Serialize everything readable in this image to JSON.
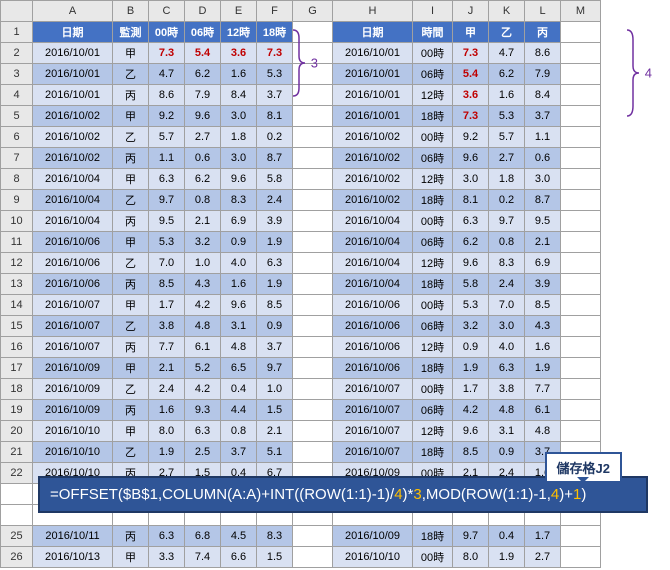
{
  "columns": [
    "A",
    "B",
    "C",
    "D",
    "E",
    "F",
    "G",
    "H",
    "I",
    "J",
    "K",
    "L",
    "M"
  ],
  "header_left": {
    "A": "日期",
    "B": "監測",
    "C": "00時",
    "D": "06時",
    "E": "12時",
    "F": "18時"
  },
  "header_right": {
    "H": "日期",
    "I": "時間",
    "J": "甲",
    "K": "乙",
    "L": "丙"
  },
  "rows_left": [
    {
      "n": 2,
      "A": "2016/10/01",
      "B": "甲",
      "C": "7.3",
      "D": "5.4",
      "E": "3.6",
      "F": "7.3",
      "red": [
        "C",
        "D",
        "E",
        "F"
      ]
    },
    {
      "n": 3,
      "A": "2016/10/01",
      "B": "乙",
      "C": "4.7",
      "D": "6.2",
      "E": "1.6",
      "F": "5.3"
    },
    {
      "n": 4,
      "A": "2016/10/01",
      "B": "丙",
      "C": "8.6",
      "D": "7.9",
      "E": "8.4",
      "F": "3.7"
    },
    {
      "n": 5,
      "A": "2016/10/02",
      "B": "甲",
      "C": "9.2",
      "D": "9.6",
      "E": "3.0",
      "F": "8.1"
    },
    {
      "n": 6,
      "A": "2016/10/02",
      "B": "乙",
      "C": "5.7",
      "D": "2.7",
      "E": "1.8",
      "F": "0.2"
    },
    {
      "n": 7,
      "A": "2016/10/02",
      "B": "丙",
      "C": "1.1",
      "D": "0.6",
      "E": "3.0",
      "F": "8.7"
    },
    {
      "n": 8,
      "A": "2016/10/04",
      "B": "甲",
      "C": "6.3",
      "D": "6.2",
      "E": "9.6",
      "F": "5.8"
    },
    {
      "n": 9,
      "A": "2016/10/04",
      "B": "乙",
      "C": "9.7",
      "D": "0.8",
      "E": "8.3",
      "F": "2.4"
    },
    {
      "n": 10,
      "A": "2016/10/04",
      "B": "丙",
      "C": "9.5",
      "D": "2.1",
      "E": "6.9",
      "F": "3.9"
    },
    {
      "n": 11,
      "A": "2016/10/06",
      "B": "甲",
      "C": "5.3",
      "D": "3.2",
      "E": "0.9",
      "F": "1.9"
    },
    {
      "n": 12,
      "A": "2016/10/06",
      "B": "乙",
      "C": "7.0",
      "D": "1.0",
      "E": "4.0",
      "F": "6.3"
    },
    {
      "n": 13,
      "A": "2016/10/06",
      "B": "丙",
      "C": "8.5",
      "D": "4.3",
      "E": "1.6",
      "F": "1.9"
    },
    {
      "n": 14,
      "A": "2016/10/07",
      "B": "甲",
      "C": "1.7",
      "D": "4.2",
      "E": "9.6",
      "F": "8.5"
    },
    {
      "n": 15,
      "A": "2016/10/07",
      "B": "乙",
      "C": "3.8",
      "D": "4.8",
      "E": "3.1",
      "F": "0.9"
    },
    {
      "n": 16,
      "A": "2016/10/07",
      "B": "丙",
      "C": "7.7",
      "D": "6.1",
      "E": "4.8",
      "F": "3.7"
    },
    {
      "n": 17,
      "A": "2016/10/09",
      "B": "甲",
      "C": "2.1",
      "D": "5.2",
      "E": "6.5",
      "F": "9.7"
    },
    {
      "n": 18,
      "A": "2016/10/09",
      "B": "乙",
      "C": "2.4",
      "D": "4.2",
      "E": "0.4",
      "F": "1.0"
    },
    {
      "n": 19,
      "A": "2016/10/09",
      "B": "丙",
      "C": "1.6",
      "D": "9.3",
      "E": "4.4",
      "F": "1.5"
    },
    {
      "n": 20,
      "A": "2016/10/10",
      "B": "甲",
      "C": "8.0",
      "D": "6.3",
      "E": "0.8",
      "F": "2.1"
    },
    {
      "n": 21,
      "A": "2016/10/10",
      "B": "乙",
      "C": "1.9",
      "D": "2.5",
      "E": "3.7",
      "F": "5.1"
    },
    {
      "n": 22,
      "A": "2016/10/10",
      "B": "丙",
      "C": "2.7",
      "D": "1.5",
      "E": "0.4",
      "F": "6.7"
    },
    {
      "n": 25,
      "A": "2016/10/11",
      "B": "丙",
      "C": "6.3",
      "D": "6.8",
      "E": "4.5",
      "F": "8.3"
    },
    {
      "n": 26,
      "A": "2016/10/13",
      "B": "甲",
      "C": "3.3",
      "D": "7.4",
      "E": "6.6",
      "F": "1.5"
    }
  ],
  "rows_right": [
    {
      "n": 2,
      "H": "2016/10/01",
      "I": "00時",
      "J": "7.3",
      "K": "4.7",
      "L": "8.6",
      "red": [
        "J"
      ]
    },
    {
      "n": 3,
      "H": "2016/10/01",
      "I": "06時",
      "J": "5.4",
      "K": "6.2",
      "L": "7.9",
      "red": [
        "J"
      ]
    },
    {
      "n": 4,
      "H": "2016/10/01",
      "I": "12時",
      "J": "3.6",
      "K": "1.6",
      "L": "8.4",
      "red": [
        "J"
      ]
    },
    {
      "n": 5,
      "H": "2016/10/01",
      "I": "18時",
      "J": "7.3",
      "K": "5.3",
      "L": "3.7",
      "red": [
        "J"
      ]
    },
    {
      "n": 6,
      "H": "2016/10/02",
      "I": "00時",
      "J": "9.2",
      "K": "5.7",
      "L": "1.1"
    },
    {
      "n": 7,
      "H": "2016/10/02",
      "I": "06時",
      "J": "9.6",
      "K": "2.7",
      "L": "0.6"
    },
    {
      "n": 8,
      "H": "2016/10/02",
      "I": "12時",
      "J": "3.0",
      "K": "1.8",
      "L": "3.0"
    },
    {
      "n": 9,
      "H": "2016/10/02",
      "I": "18時",
      "J": "8.1",
      "K": "0.2",
      "L": "8.7"
    },
    {
      "n": 10,
      "H": "2016/10/04",
      "I": "00時",
      "J": "6.3",
      "K": "9.7",
      "L": "9.5"
    },
    {
      "n": 11,
      "H": "2016/10/04",
      "I": "06時",
      "J": "6.2",
      "K": "0.8",
      "L": "2.1"
    },
    {
      "n": 12,
      "H": "2016/10/04",
      "I": "12時",
      "J": "9.6",
      "K": "8.3",
      "L": "6.9"
    },
    {
      "n": 13,
      "H": "2016/10/04",
      "I": "18時",
      "J": "5.8",
      "K": "2.4",
      "L": "3.9"
    },
    {
      "n": 14,
      "H": "2016/10/06",
      "I": "00時",
      "J": "5.3",
      "K": "7.0",
      "L": "8.5"
    },
    {
      "n": 15,
      "H": "2016/10/06",
      "I": "06時",
      "J": "3.2",
      "K": "3.0",
      "L": "4.3"
    },
    {
      "n": 16,
      "H": "2016/10/06",
      "I": "12時",
      "J": "0.9",
      "K": "4.0",
      "L": "1.6"
    },
    {
      "n": 17,
      "H": "2016/10/06",
      "I": "18時",
      "J": "1.9",
      "K": "6.3",
      "L": "1.9"
    },
    {
      "n": 18,
      "H": "2016/10/07",
      "I": "00時",
      "J": "1.7",
      "K": "3.8",
      "L": "7.7"
    },
    {
      "n": 19,
      "H": "2016/10/07",
      "I": "06時",
      "J": "4.2",
      "K": "4.8",
      "L": "6.1"
    },
    {
      "n": 20,
      "H": "2016/10/07",
      "I": "12時",
      "J": "9.6",
      "K": "3.1",
      "L": "4.8"
    },
    {
      "n": 21,
      "H": "2016/10/07",
      "I": "18時",
      "J": "8.5",
      "K": "0.9",
      "L": "3.7"
    },
    {
      "n": 22,
      "H": "2016/10/09",
      "I": "00時",
      "J": "2.1",
      "K": "2.4",
      "L": "1.6"
    },
    {
      "n": 25,
      "H": "2016/10/09",
      "I": "18時",
      "J": "9.7",
      "K": "0.4",
      "L": "1.7"
    },
    {
      "n": 26,
      "H": "2016/10/10",
      "I": "00時",
      "J": "8.0",
      "K": "1.9",
      "L": "2.7"
    }
  ],
  "brace_left_label": "3",
  "brace_right_label": "4",
  "callout_label": "儲存格J2",
  "formula": {
    "p1": "=OFFSET($B$1,COLUMN(A:A)+INT((ROW(1:1)-1)/",
    "o1": "4",
    "p2": ")*",
    "o2": "3",
    "p3": ",MOD(ROW(1:1)-1,",
    "o3": "4",
    "p4": ")+",
    "o4": "1",
    "p5": ")"
  }
}
